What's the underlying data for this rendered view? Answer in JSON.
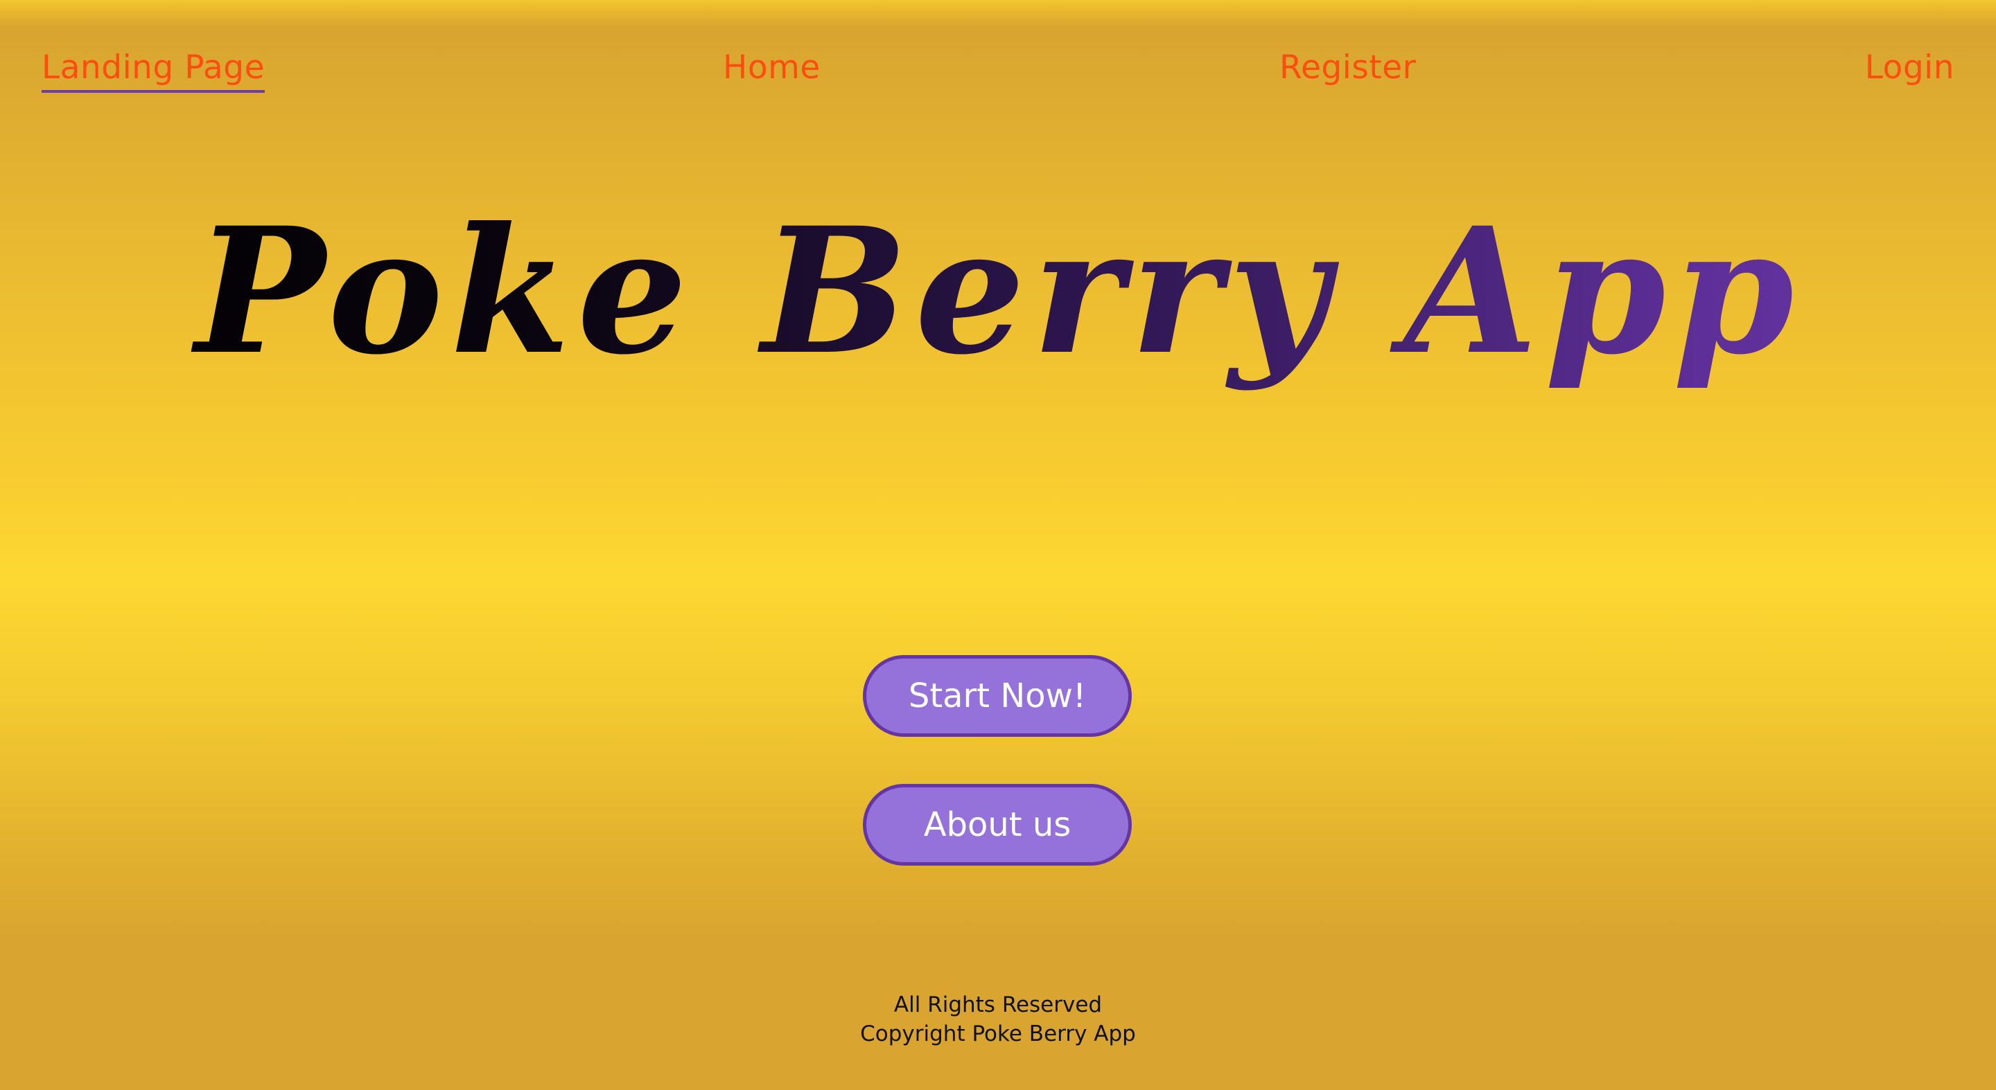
{
  "nav": {
    "landing_label": "Landing Page",
    "home_label": "Home",
    "register_label": "Register",
    "login_label": "Login"
  },
  "hero": {
    "title": "Poke Berry App"
  },
  "buttons": {
    "start_label": "Start Now!",
    "about_label": "About us"
  },
  "footer": {
    "rights": "All Rights Reserved",
    "copyright": "Copyright Poke Berry App"
  },
  "colors": {
    "nav_link": "#ff4d10",
    "active_underline": "#6b3fa0",
    "button_fill": "#9472d9",
    "button_border": "#6435a5",
    "title_start": "#000000",
    "title_end": "#6a35a8"
  }
}
